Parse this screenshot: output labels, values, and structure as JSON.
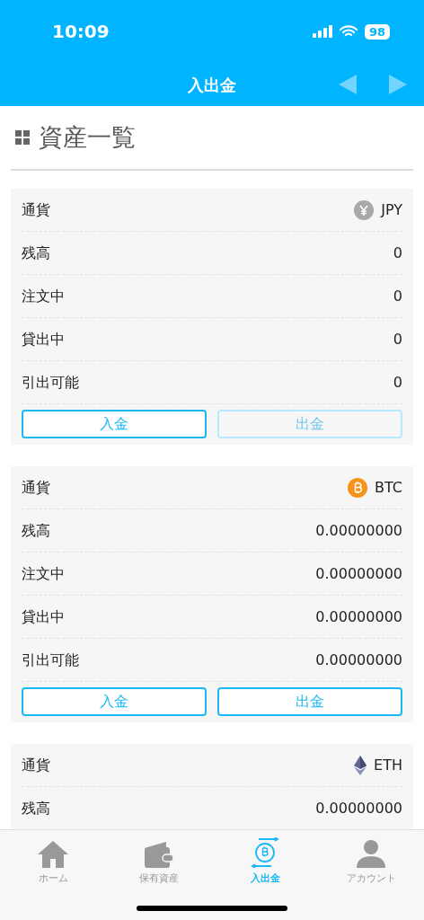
{
  "status_bar": {
    "time": "10:09",
    "battery": "98"
  },
  "header": {
    "title": "入出金",
    "prev_disabled": true,
    "next_disabled": true
  },
  "section_title": "資産一覧",
  "cards": [
    {
      "kind": "jpy",
      "currency_label": "通貨",
      "currency": "JPY",
      "rows": [
        {
          "label": "残高",
          "value": "0"
        },
        {
          "label": "注文中",
          "value": "0"
        },
        {
          "label": "貸出中",
          "value": "0"
        },
        {
          "label": "引出可能",
          "value": "0"
        }
      ],
      "buttons": [
        {
          "label": "入金",
          "disabled": false
        },
        {
          "label": "出金",
          "disabled": true
        }
      ]
    },
    {
      "kind": "btc",
      "currency_label": "通貨",
      "currency": "BTC",
      "rows": [
        {
          "label": "残高",
          "value": "0.00000000"
        },
        {
          "label": "注文中",
          "value": "0.00000000"
        },
        {
          "label": "貸出中",
          "value": "0.00000000"
        },
        {
          "label": "引出可能",
          "value": "0.00000000"
        }
      ],
      "buttons": [
        {
          "label": "入金",
          "disabled": false
        },
        {
          "label": "出金",
          "disabled": false
        }
      ]
    },
    {
      "kind": "eth",
      "currency_label": "通貨",
      "currency": "ETH",
      "rows": [
        {
          "label": "残高",
          "value": "0.00000000"
        }
      ]
    }
  ],
  "tab_bar": [
    {
      "kind": "home",
      "label": "ホーム",
      "selected": false
    },
    {
      "kind": "wallet",
      "label": "保有資産",
      "selected": false
    },
    {
      "kind": "transfer",
      "label": "入出金",
      "selected": true
    },
    {
      "kind": "account",
      "label": "アカウント",
      "selected": false
    }
  ]
}
